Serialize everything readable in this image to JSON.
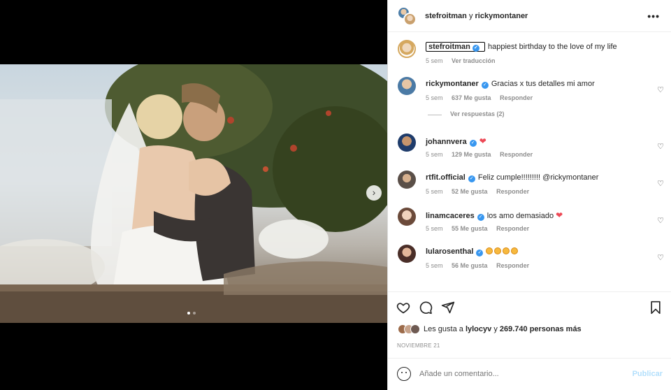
{
  "header": {
    "user1": "stefroitman",
    "conj": "y",
    "user2": "rickymontaner",
    "more": "•••"
  },
  "caption": {
    "user": "stefroitman",
    "text": "happiest birthday to the love of my life",
    "time": "5 sem",
    "translate": "Ver traducción"
  },
  "comments": [
    {
      "user": "rickymontaner",
      "text": "Gracias x tus detalles mi amor",
      "time": "5 sem",
      "likes": "637 Me gusta",
      "reply": "Responder",
      "avatar_color": "#4b7aa5"
    },
    {
      "user": "johannvera",
      "text": "",
      "time": "5 sem",
      "likes": "129 Me gusta",
      "reply": "Responder",
      "avatar_color": "#1f3c6b"
    },
    {
      "user": "rtfit.official",
      "text": "Feliz cumple!!!!!!!!! @rickymontaner",
      "time": "5 sem",
      "likes": "52 Me gusta",
      "reply": "Responder",
      "avatar_color": "#5a4f48"
    },
    {
      "user": "linamcaceres",
      "text": "los amo demasiado",
      "time": "5 sem",
      "likes": "55 Me gusta",
      "reply": "Responder",
      "avatar_color": "#b8927a"
    },
    {
      "user": "lularosenthal",
      "text": "",
      "time": "5 sem",
      "likes": "56 Me gusta",
      "reply": "Responder",
      "avatar_color": "#6b3f36"
    }
  ],
  "replies": "Ver respuestas (2)",
  "likes": {
    "prefix": "Les gusta a",
    "user": "lylocyv",
    "conj": "y",
    "count": "269.740 personas más"
  },
  "date": "NOVIEMBRE 21",
  "add_comment": {
    "placeholder": "Añade un comentario...",
    "publish": "Publicar"
  },
  "icons": {
    "heart": "heart-icon",
    "comment": "comment-icon",
    "share": "share-icon",
    "bookmark": "bookmark-icon"
  }
}
